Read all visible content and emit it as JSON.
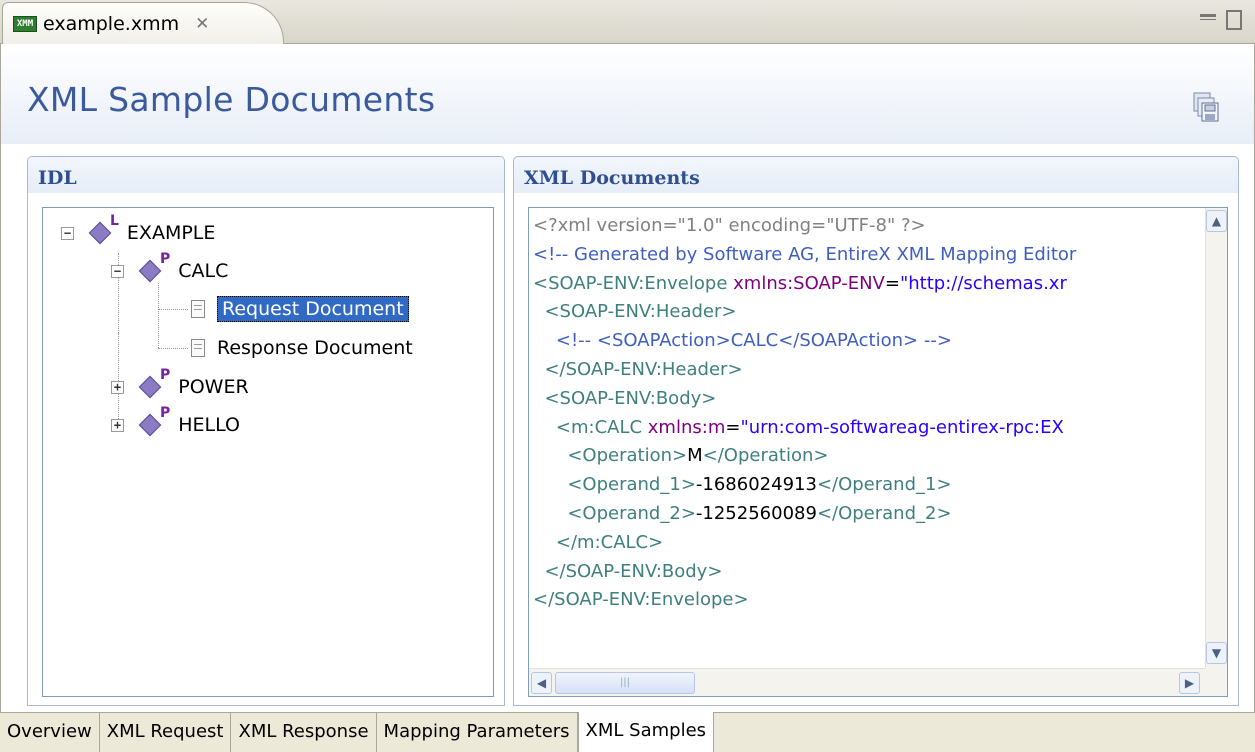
{
  "editor_tab": {
    "icon_text": "XMM",
    "title": "example.xmm"
  },
  "form_title": "XML Sample Documents",
  "idl_section": {
    "title": "IDL",
    "tree": {
      "root": {
        "label": "EXAMPLE",
        "badge": "L"
      },
      "calc": {
        "label": "CALC",
        "badge": "P"
      },
      "request": {
        "label": "Request Document"
      },
      "response": {
        "label": "Response Document"
      },
      "power": {
        "label": "POWER",
        "badge": "P"
      },
      "hello": {
        "label": "HELLO",
        "badge": "P"
      }
    }
  },
  "xml_section": {
    "title": "XML Documents",
    "lines": [
      "<?xml version=\"1.0\" encoding=\"UTF-8\" ?>",
      "<!-- Generated by Software AG, EntireX XML Mapping Editor",
      "<SOAP-ENV:Envelope xmlns:SOAP-ENV=\"http://schemas.xr",
      "  <SOAP-ENV:Header>",
      "    <!-- <SOAPAction>CALC</SOAPAction> -->",
      "  </SOAP-ENV:Header>",
      "  <SOAP-ENV:Body>",
      "    <m:CALC xmlns:m=\"urn:com-softwareag-entirex-rpc:EX",
      "      <Operation>M</Operation>",
      "      <Operand_1>-1686024913</Operand_1>",
      "      <Operand_2>-1252560089</Operand_2>",
      "    </m:CALC>",
      "  </SOAP-ENV:Body>",
      "</SOAP-ENV:Envelope>"
    ]
  },
  "bottom_tabs": {
    "overview": "Overview",
    "xml_request": "XML Request",
    "xml_response": "XML Response",
    "mapping_parameters": "Mapping Parameters",
    "xml_samples": "XML Samples",
    "active": "XML Samples"
  },
  "colors": {
    "title": "#3a5a9c",
    "selection": "#316ac5",
    "xml_tag": "#3f7f7f",
    "xml_attr": "#7f007f",
    "xml_value": "#2a00ff",
    "xml_comment": "#3f5fbf"
  }
}
